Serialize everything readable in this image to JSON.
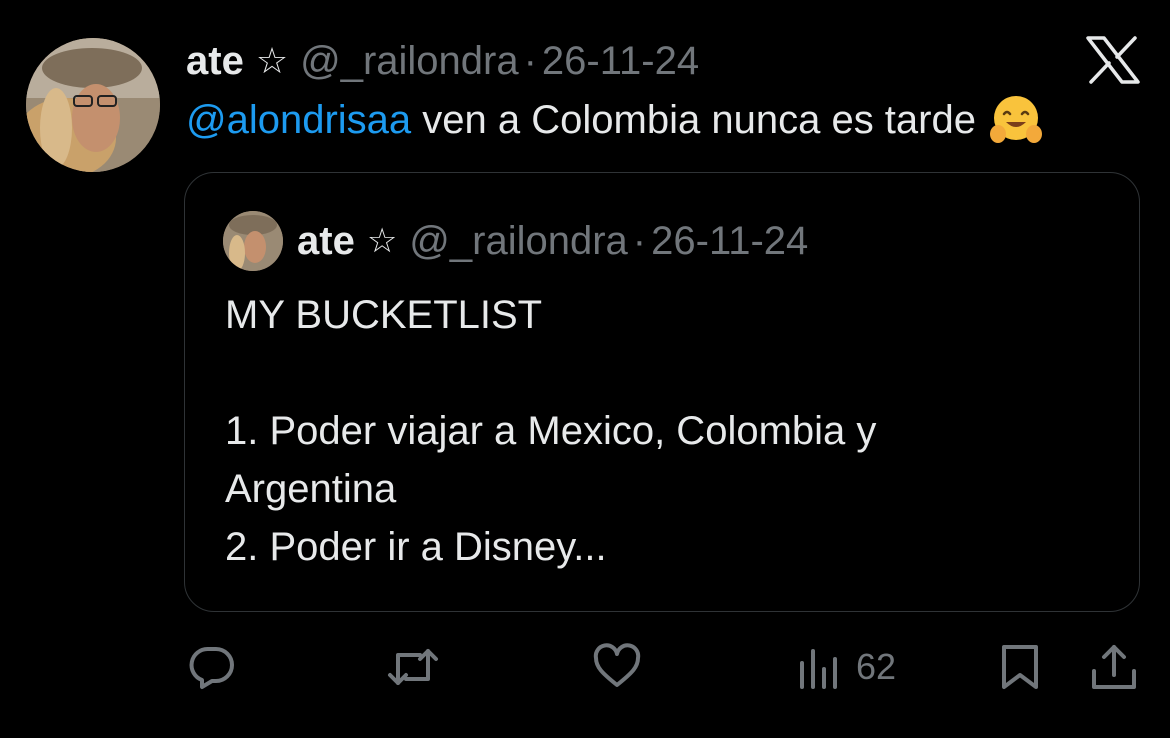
{
  "tweet": {
    "author_name": "ate",
    "author_symbol": "☆",
    "handle": "@_railondra",
    "separator": "·",
    "date": "26-11-24",
    "mention": "@alondrisaa",
    "text": " ven a Colombia nunca es tarde",
    "emoji": "hugging-face-emoji",
    "logo_icon": "x-logo-icon"
  },
  "quote": {
    "author_name": "ate",
    "author_symbol": "☆",
    "handle": "@_railondra",
    "separator": "·",
    "date": "26-11-24",
    "lines": [
      "MY BUCKETLIST",
      "",
      "1. Poder viajar a Mexico, Colombia y",
      "Argentina",
      "2. Poder ir a Disney..."
    ]
  },
  "actions": {
    "reply_icon": "reply-icon",
    "retweet_icon": "retweet-icon",
    "like_icon": "heart-icon",
    "views_icon": "views-icon",
    "views_count": "62",
    "bookmark_icon": "bookmark-icon",
    "share_icon": "share-icon"
  },
  "colors": {
    "background": "#000000",
    "text": "#e7e9ea",
    "secondary": "#71767b",
    "accent": "#1d9bf0",
    "border": "#2f3336"
  }
}
